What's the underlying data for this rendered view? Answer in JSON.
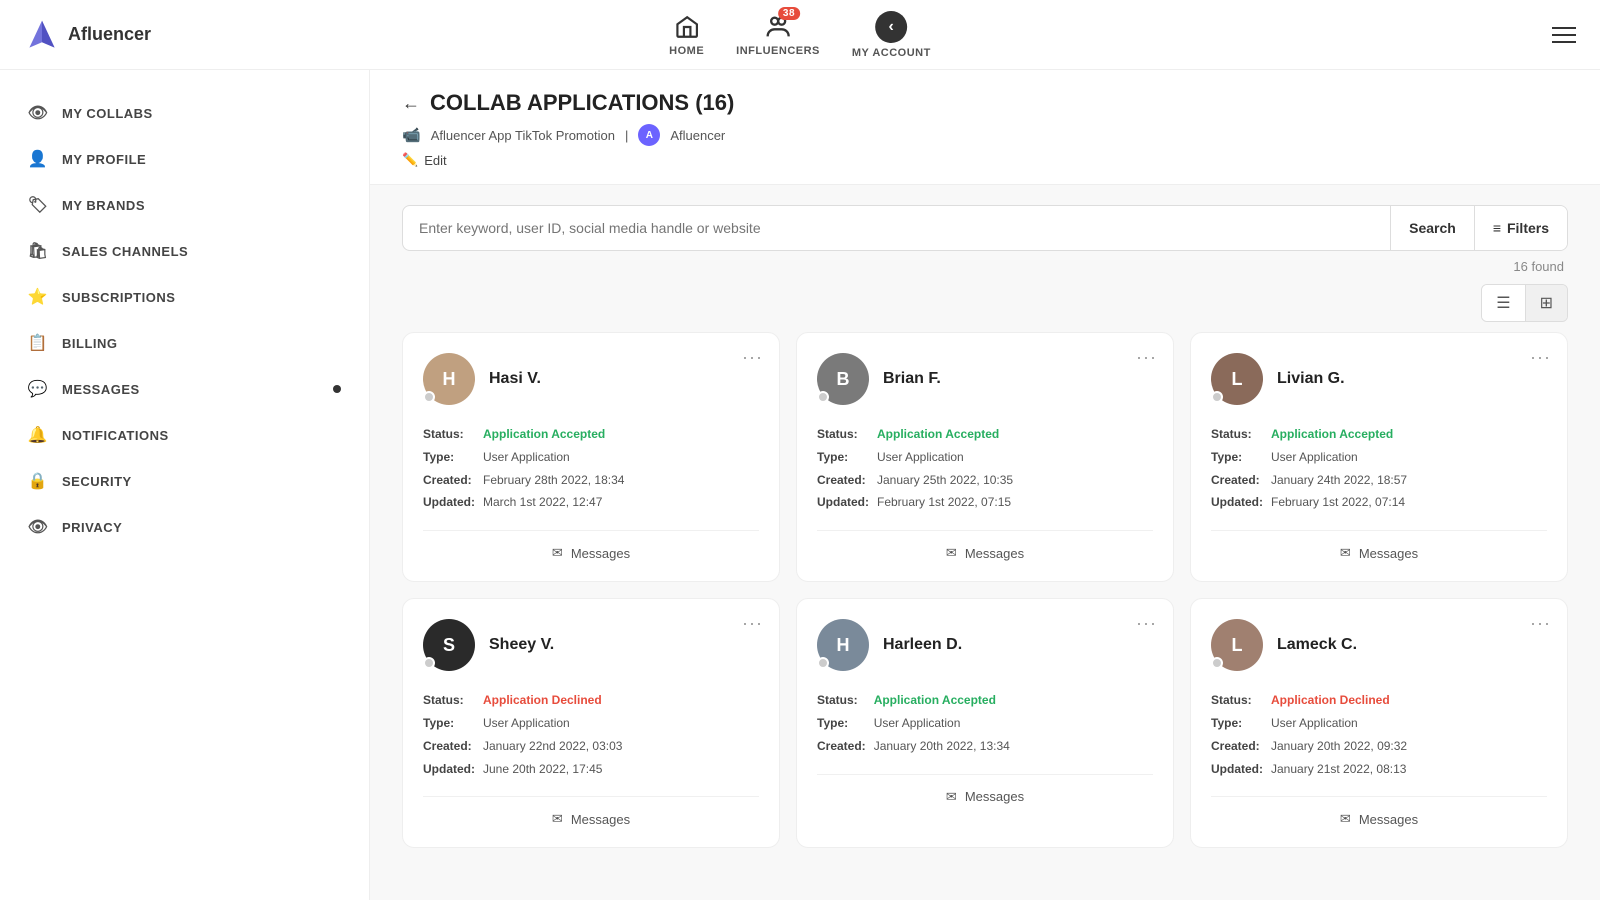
{
  "app": {
    "name": "Afluencer"
  },
  "topnav": {
    "home_label": "HOME",
    "influencers_label": "INFLUENCERS",
    "my_account_label": "MY ACCOUNT",
    "badge_count": "38"
  },
  "sidebar": {
    "items": [
      {
        "id": "my-collabs",
        "label": "MY COLLABS",
        "icon": "👁"
      },
      {
        "id": "my-profile",
        "label": "MY PROFILE",
        "icon": "👤"
      },
      {
        "id": "my-brands",
        "label": "MY BRANDS",
        "icon": "🏷"
      },
      {
        "id": "sales-channels",
        "label": "SALES CHANNELS",
        "icon": "🛍"
      },
      {
        "id": "subscriptions",
        "label": "SUBSCRIPTIONS",
        "icon": "⭐"
      },
      {
        "id": "billing",
        "label": "BILLING",
        "icon": "📋"
      },
      {
        "id": "messages",
        "label": "MESSAGES",
        "icon": "💬"
      },
      {
        "id": "notifications",
        "label": "NOTIFICATIONS",
        "icon": "🔔"
      },
      {
        "id": "security",
        "label": "SECURITY",
        "icon": "🔒"
      },
      {
        "id": "privacy",
        "label": "PRIVACY",
        "icon": "👁"
      }
    ]
  },
  "page": {
    "title": "COLLAB APPLICATIONS (16)",
    "collab_name": "Afluencer App TikTok Promotion",
    "brand_name": "Afluencer",
    "edit_label": "Edit",
    "search_placeholder": "Enter keyword, user ID, social media handle or website",
    "search_button": "Search",
    "filters_button": "Filters",
    "found_count": "16 found"
  },
  "cards": [
    {
      "name": "Hasi V.",
      "status": "Application Accepted",
      "status_type": "accepted",
      "type": "User Application",
      "created": "February 28th 2022, 18:34",
      "updated": "March 1st 2022, 12:47",
      "avatar_color": "#c0a080",
      "avatar_initial": "H"
    },
    {
      "name": "Brian F.",
      "status": "Application Accepted",
      "status_type": "accepted",
      "type": "User Application",
      "created": "January 25th 2022, 10:35",
      "updated": "February 1st 2022, 07:15",
      "avatar_color": "#7a7a7a",
      "avatar_initial": "B"
    },
    {
      "name": "Livian G.",
      "status": "Application Accepted",
      "status_type": "accepted",
      "type": "User Application",
      "created": "January 24th 2022, 18:57",
      "updated": "February 1st 2022, 07:14",
      "avatar_color": "#8a6a5a",
      "avatar_initial": "L"
    },
    {
      "name": "Sheey V.",
      "status": "Application Declined",
      "status_type": "declined",
      "type": "User Application",
      "created": "January 22nd 2022, 03:03",
      "updated": "June 20th 2022, 17:45",
      "avatar_color": "#2a2a2a",
      "avatar_initial": "S"
    },
    {
      "name": "Harleen D.",
      "status": "Application Accepted",
      "status_type": "accepted",
      "type": "User Application",
      "created": "January 20th 2022, 13:34",
      "updated": "",
      "avatar_color": "#7a8a9a",
      "avatar_initial": "H"
    },
    {
      "name": "Lameck C.",
      "status": "Application Declined",
      "status_type": "declined",
      "type": "User Application",
      "created": "January 20th 2022, 09:32",
      "updated": "January 21st 2022, 08:13",
      "avatar_color": "#a08070",
      "avatar_initial": "L"
    }
  ],
  "card_labels": {
    "status": "Status:",
    "type": "Type:",
    "created": "Created:",
    "updated": "Updated:",
    "messages": "Messages",
    "menu": "···"
  }
}
